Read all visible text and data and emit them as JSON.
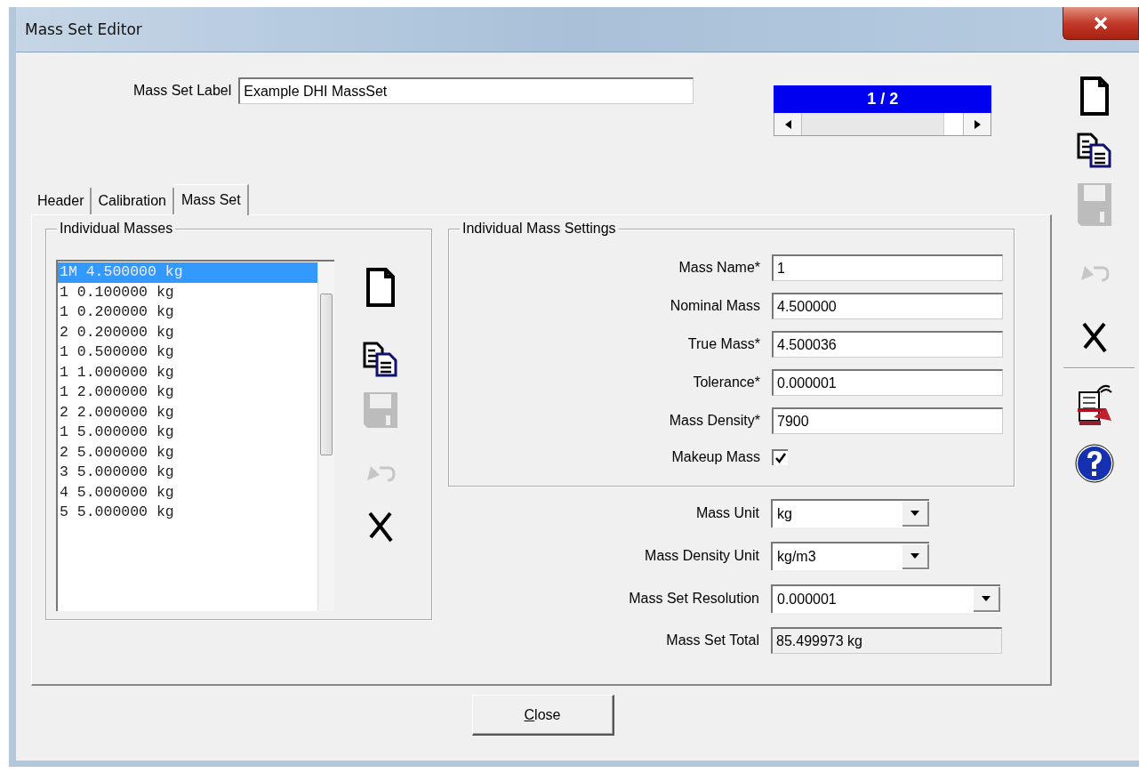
{
  "window": {
    "title": "Mass Set Editor"
  },
  "mass_set_label": {
    "label": "Mass Set Label",
    "value": "Example DHI MassSet"
  },
  "pager": {
    "text": "1 / 2",
    "level": 1
  },
  "tabs": [
    {
      "label": "Header",
      "selected": false
    },
    {
      "label": "Calibration",
      "selected": false
    },
    {
      "label": "Mass Set",
      "selected": true
    }
  ],
  "individual_masses": {
    "title": "Individual Masses",
    "items": [
      {
        "text": "1M 4.500000 kg",
        "selected": true
      },
      {
        "text": "1 0.100000 kg",
        "selected": false
      },
      {
        "text": "1 0.200000 kg",
        "selected": false
      },
      {
        "text": "2 0.200000 kg",
        "selected": false
      },
      {
        "text": "1 0.500000 kg",
        "selected": false
      },
      {
        "text": "1 1.000000 kg",
        "selected": false
      },
      {
        "text": "1 2.000000 kg",
        "selected": false
      },
      {
        "text": "2 2.000000 kg",
        "selected": false
      },
      {
        "text": "1 5.000000 kg",
        "selected": false
      },
      {
        "text": "2 5.000000 kg",
        "selected": false
      },
      {
        "text": "3 5.000000 kg",
        "selected": false
      },
      {
        "text": "4 5.000000 kg",
        "selected": false
      },
      {
        "text": "5 5.000000 kg",
        "selected": false
      }
    ],
    "tools": [
      {
        "kind": "new",
        "disabled": false
      },
      {
        "kind": "copy",
        "disabled": false
      },
      {
        "kind": "save",
        "disabled": true
      },
      {
        "kind": "undo",
        "disabled": true
      },
      {
        "kind": "delete",
        "disabled": false
      }
    ]
  },
  "mass_settings": {
    "title": "Individual Mass Settings",
    "fields": [
      {
        "label": "Mass Name*",
        "value": "1"
      },
      {
        "label": "Nominal Mass",
        "value": "4.500000"
      },
      {
        "label": "True Mass*",
        "value": "4.500036"
      },
      {
        "label": "Tolerance*",
        "value": "0.000001"
      },
      {
        "label": "Mass Density*",
        "value": "7900"
      }
    ],
    "makeup_mass": {
      "label": "Makeup Mass",
      "checked": true
    }
  },
  "units": [
    {
      "label": "Mass Unit",
      "value": "kg",
      "kind": "short"
    },
    {
      "label": "Mass Density Unit",
      "value": "kg/m3",
      "kind": "short"
    },
    {
      "label": "Mass Set Resolution",
      "value": "0.000001",
      "kind": "wide"
    }
  ],
  "mass_set_total": {
    "label": "Mass Set Total",
    "value": "85.499973 kg"
  },
  "close_button": {
    "label": "Close"
  },
  "toolbar": [
    {
      "kind": "new",
      "disabled": false
    },
    {
      "kind": "copy",
      "disabled": false
    },
    {
      "kind": "save",
      "disabled": true
    },
    {
      "kind": "undo",
      "disabled": true
    },
    {
      "kind": "delete",
      "disabled": false
    },
    {
      "kind": "separator",
      "disabled": false
    },
    {
      "kind": "report",
      "disabled": false
    },
    {
      "kind": "help",
      "disabled": false
    }
  ]
}
